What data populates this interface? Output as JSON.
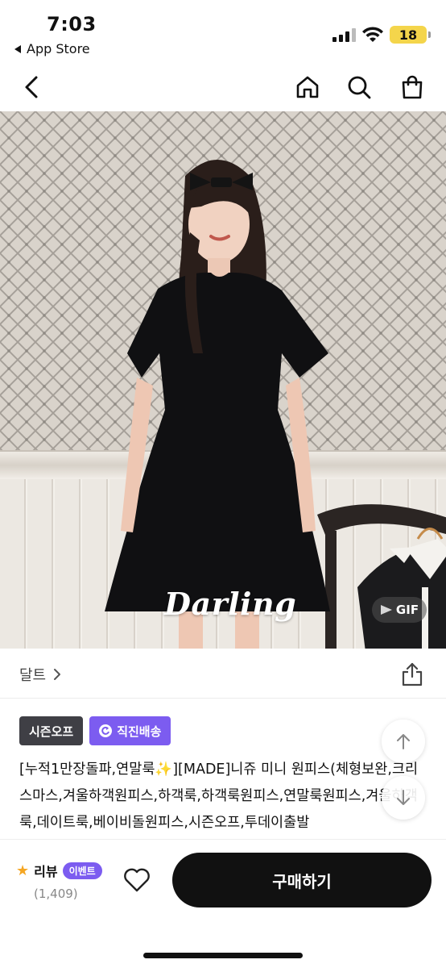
{
  "status_bar": {
    "time": "7:03",
    "back_app_label": "App Store",
    "battery": "18",
    "battery_color": "#f4d54b"
  },
  "hero": {
    "overlay_text": "Darling",
    "gif_label": "GIF"
  },
  "brand": {
    "name": "달트"
  },
  "badges": [
    {
      "label": "시즌오프",
      "color": "#3f3f45"
    },
    {
      "label": "직진배송",
      "color": "#7c5cf0"
    }
  ],
  "product": {
    "title": "[누적1만장돌파,연말룩✨][MADE]니쥬 미니 원피스(체형보완,크리스마스,겨울하객원피스,하객룩,하객룩원피스,연말룩원피스,겨울하객룩,데이트룩,베이비돌원피스,시즌오프,투데이출발"
  },
  "bottom_bar": {
    "review_label": "리뷰",
    "event_label": "이벤트",
    "review_count": "(1,409)",
    "buy_label": "구매하기"
  },
  "icons": {
    "back": "chevron-left-icon",
    "home": "home-icon",
    "search": "search-icon",
    "bag": "shopping-bag-icon",
    "share": "share-icon",
    "scroll_up": "arrow-up-icon",
    "scroll_down": "arrow-down-icon",
    "wishlist": "heart-icon",
    "rating": "star-icon"
  }
}
